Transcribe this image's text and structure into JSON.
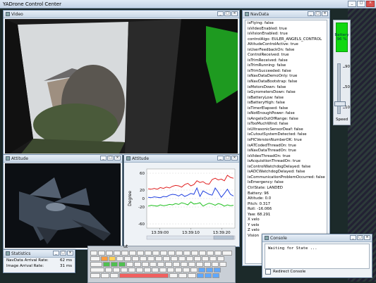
{
  "app": {
    "title": "YADrone Control Center"
  },
  "video_window": {
    "title": "Video"
  },
  "navdata_window": {
    "title": "NavData",
    "lines": [
      "isFlying: false",
      "isVideoEnabled: true",
      "isVisionEnabled: true",
      "controlAlgo: EULER_ANGELS_CONTROL",
      "AltitudeControlActive: true",
      "isUserFeedbackOn: false",
      "ControlReceived: true",
      "isTrimReceived: false",
      "isTrimRunning: false",
      "isTrimSucceeded: false",
      "isNavDataDemoOnly: true",
      "isNavDataBootstrap: false",
      "isMotorsDown: false",
      "isGyrometersDown: false",
      "isBatteryLow: false",
      "isBatteryHigh: false",
      "isTimerElapsed: false",
      "isNotEnoughPower: false",
      "isAngelsOutOfRange: false",
      "isTooMuchWind: false",
      "isUltrasonicSensorDeaf: false",
      "isCutoutSystemDetected: false",
      "isPICVersionNumberOK: true",
      "isATCodedThreadOn: true",
      "isNavDataThreadOn: true",
      "isVideoThreadOn: true",
      "isAcquisitionThreadOn: true",
      "isControlWatchdogDelayed: false",
      "isADCWatchdogDelayed: false",
      "isCommunicationProblemOccurred: false",
      "IsEmergency: false",
      "CtrlState: LANDED",
      "Battery: 96",
      "Altitude: 0.0",
      "Pitch: 0.317",
      "Roll: -16.066",
      "Yaw: 68.291",
      "X velo",
      "Y velo",
      "Z velo",
      "Vision"
    ]
  },
  "battery": {
    "label": "Battery",
    "value": "96 %",
    "percent": 96
  },
  "speed": {
    "label": "Speed",
    "ticks": [
      "90",
      "50",
      "10"
    ],
    "value": 20
  },
  "attitude_window": {
    "title": "Attitude"
  },
  "attitude_chart_window": {
    "title": "Attitude"
  },
  "chart_data": {
    "type": "line",
    "ylabel": "Degree",
    "ylim": [
      -70,
      70
    ],
    "yticks": [
      "60",
      "20",
      "0",
      "-20",
      "-60"
    ],
    "xticks": [
      "13:39:00",
      "13:39:10",
      "13:39:20"
    ],
    "series": [
      {
        "name": "",
        "color": "#e02020",
        "values": [
          23,
          22,
          24,
          22,
          26,
          24,
          27,
          25,
          29,
          31,
          30,
          27,
          33,
          36,
          30,
          33,
          42,
          38,
          40,
          35,
          34,
          45,
          48,
          44,
          46,
          42,
          55,
          50,
          48
        ]
      },
      {
        "name": "",
        "color": "#2040e0",
        "values": [
          3,
          2,
          4,
          3,
          2,
          5,
          4,
          8,
          10,
          9,
          6,
          10,
          5,
          8,
          12,
          10,
          25,
          5,
          18,
          14,
          10,
          8,
          25,
          15,
          3,
          12,
          22,
          10,
          6
        ]
      },
      {
        "name": "",
        "color": "#20c020",
        "values": [
          -18,
          -16,
          -17,
          -18,
          -15,
          -17,
          -16,
          -14,
          -15,
          -12,
          -14,
          -10,
          -12,
          -15,
          -8,
          -13,
          -12,
          -10,
          -18,
          -14,
          -11,
          -13,
          -16,
          -12,
          -14,
          -18,
          -15,
          -17,
          -16
        ]
      }
    ]
  },
  "statistics_window": {
    "title": "Statistics",
    "rows": [
      {
        "label": "NavData Arrival Rate:",
        "value": "62 ms"
      },
      {
        "label": "Image Arrival Rate:",
        "value": "31 ms"
      }
    ]
  },
  "console_window": {
    "title": "Console",
    "text": "Waiting for State ...",
    "redirect_label": "Redirect Console"
  },
  "keyboard_window": {
    "title_fragment": "ut"
  }
}
